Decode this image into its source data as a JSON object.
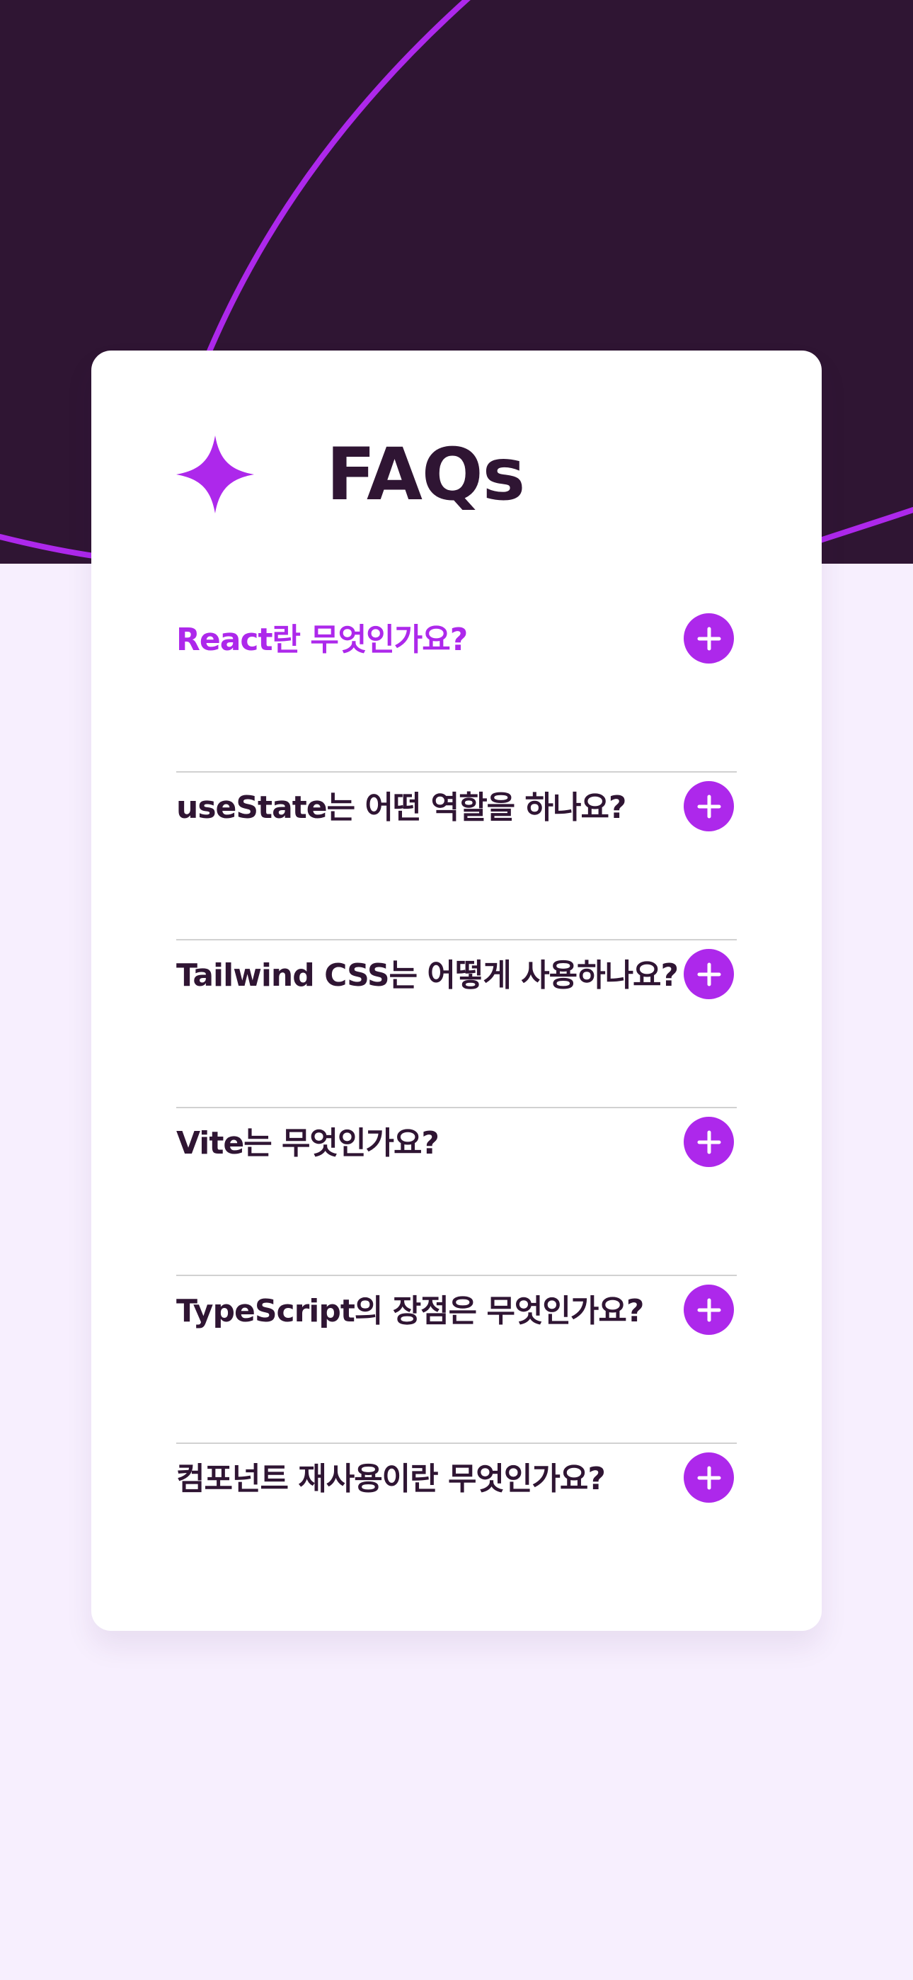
{
  "page": {
    "title": "FAQs"
  },
  "theme": {
    "hero_background": "#2f1533",
    "page_background": "#f7effe",
    "card_background": "#ffffff",
    "accent": "#ad28eb",
    "text": "#2f1533",
    "divider": "#d1d1d1"
  },
  "icons": {
    "header": "four-point-star-icon",
    "toggle": "plus-icon"
  },
  "faqs": [
    {
      "question": "React란 무엇인가요?",
      "active": true
    },
    {
      "question": "useState는 어떤 역할을 하나요?",
      "active": false
    },
    {
      "question": "Tailwind CSS는 어떻게 사용하나요?",
      "active": false
    },
    {
      "question": "Vite는 무엇인가요?",
      "active": false
    },
    {
      "question": "TypeScript의 장점은 무엇인가요?",
      "active": false
    },
    {
      "question": "컴포넌트 재사용이란 무엇인가요?",
      "active": false
    }
  ]
}
